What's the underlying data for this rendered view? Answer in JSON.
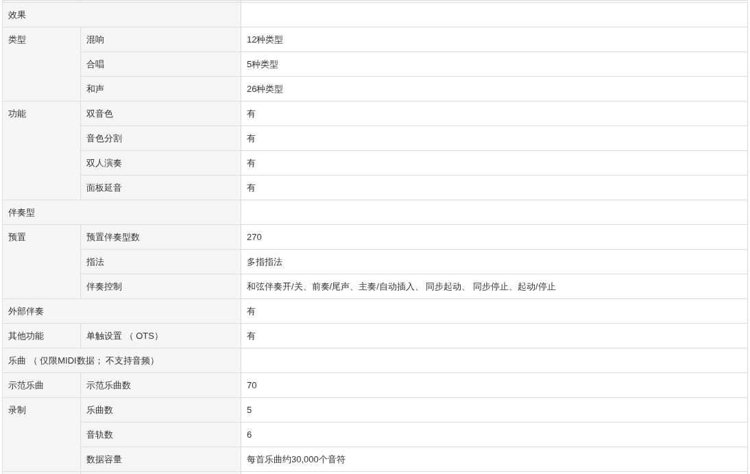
{
  "rows": [
    {
      "kind": "section",
      "label": "效果"
    },
    {
      "kind": "group",
      "label": "类型",
      "items": [
        {
          "label": "混响",
          "value": "12种类型"
        },
        {
          "label": "合唱",
          "value": "5种类型"
        },
        {
          "label": "和声",
          "value": "26种类型"
        }
      ]
    },
    {
      "kind": "group",
      "label": "功能",
      "items": [
        {
          "label": "双音色",
          "value": "有"
        },
        {
          "label": "音色分割",
          "value": "有"
        },
        {
          "label": "双人演奏",
          "value": "有"
        },
        {
          "label": "面板延音",
          "value": "有"
        }
      ]
    },
    {
      "kind": "section",
      "label": "伴奏型"
    },
    {
      "kind": "group",
      "label": "预置",
      "items": [
        {
          "label": "预置伴奏型数",
          "value": "270"
        },
        {
          "label": "指法",
          "value": "多指指法"
        },
        {
          "label": "伴奏控制",
          "value": "和弦伴奏开/关、前奏/尾声、主奏/自动插入、 同步起动、 同步停止、起动/停止"
        }
      ]
    },
    {
      "kind": "section",
      "label": "外部伴奏",
      "value": "有"
    },
    {
      "kind": "group",
      "label": "其他功能",
      "items": [
        {
          "label": "单触设置 （ OTS）",
          "value": "有"
        }
      ]
    },
    {
      "kind": "section",
      "label": "乐曲 （ 仅限MIDI数据； 不支持音频）"
    },
    {
      "kind": "group",
      "label": "示范乐曲",
      "items": [
        {
          "label": "示范乐曲数",
          "value": "70"
        }
      ]
    },
    {
      "kind": "group",
      "label": "录制",
      "items": [
        {
          "label": "乐曲数",
          "value": "5"
        },
        {
          "label": "音轨数",
          "value": "6"
        },
        {
          "label": "数据容量",
          "value": "每首乐曲约30,000个音符"
        }
      ]
    }
  ]
}
